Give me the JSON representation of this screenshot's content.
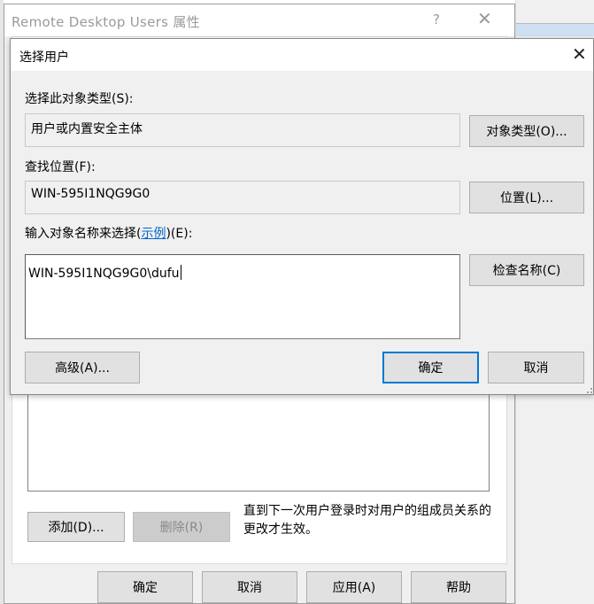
{
  "background_window": {
    "title": "Remote Desktop Users 属性",
    "help_glyph": "?",
    "close_glyph": "✕",
    "note": "直到下一次用户登录时对用户的组成员关系的更改才生效。",
    "buttons": {
      "add": "添加(D)...",
      "remove": "删除(R)",
      "ok": "确定",
      "cancel": "取消",
      "apply": "应用(A)",
      "help": "帮助"
    }
  },
  "dialog": {
    "title": "选择用户",
    "close_glyph": "✕",
    "object_type_label": "选择此对象类型(S):",
    "object_type_value": "用户或内置安全主体",
    "object_types_button": "对象类型(O)...",
    "location_label": "查找位置(F):",
    "location_value": "WIN-595I1NQG9G0",
    "locations_button": "位置(L)...",
    "names_label_prefix": "输入对象名称来选择(",
    "names_label_link": "示例",
    "names_label_suffix": ")(E):",
    "names_value": "WIN-595I1NQG9G0\\dufu",
    "check_names_button": "检查名称(C)",
    "advanced_button": "高级(A)...",
    "ok_button": "确定",
    "cancel_button": "取消"
  },
  "colors": {
    "accent": "#0078d7",
    "link": "#0066cc",
    "dialog_bg": "#f0f0f0",
    "button_bg": "#e1e1e1"
  }
}
